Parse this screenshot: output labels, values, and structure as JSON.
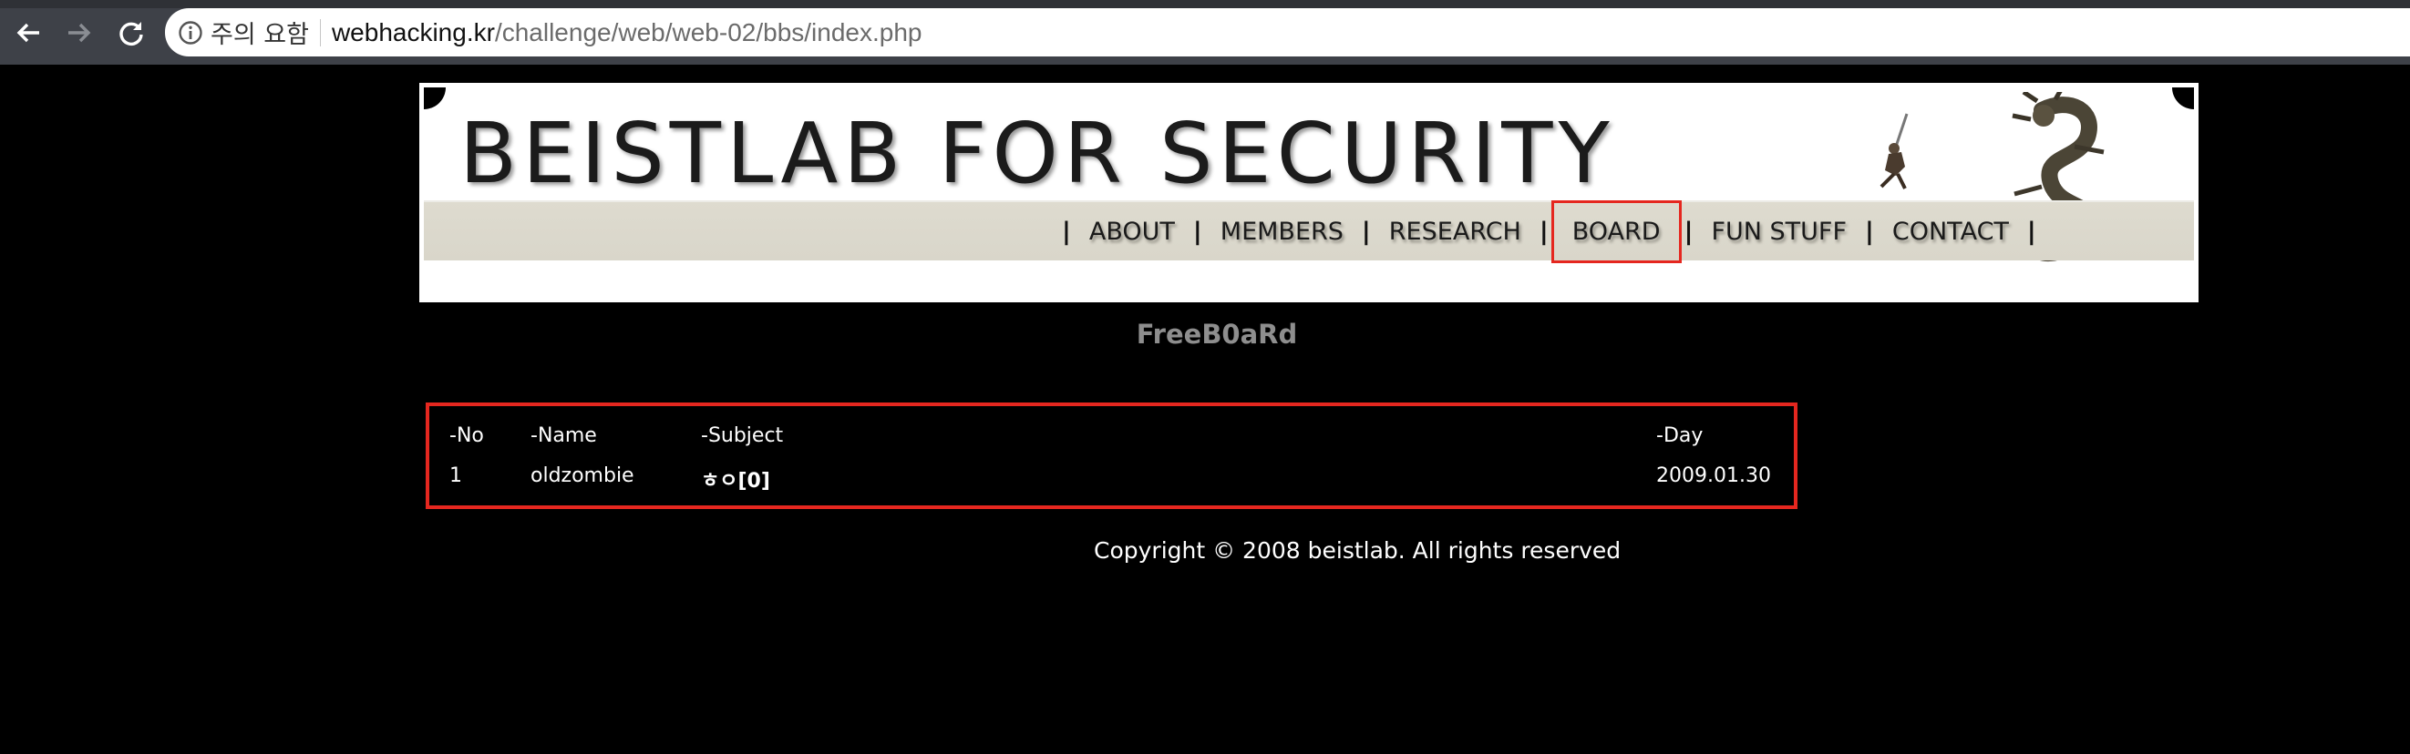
{
  "browser": {
    "back_icon": "arrow-left-icon",
    "forward_icon": "arrow-right-icon",
    "reload_icon": "reload-icon",
    "security_icon": "info-circle-icon",
    "security_label": "주의 요함",
    "url_host": "webhacking.kr",
    "url_path": "/challenge/web/web-02/bbs/index.php"
  },
  "header": {
    "logo": "BEISTLAB FOR SECURITY",
    "menu": [
      "ABOUT",
      "MEMBERS",
      "RESEARCH",
      "BOARD",
      "FUN STUFF",
      "CONTACT"
    ],
    "active_menu": "BOARD",
    "pipe": "|"
  },
  "board": {
    "title": "FreeB0aRd",
    "headers": {
      "no": "-No",
      "name": "-Name",
      "subject": "-Subject",
      "day": "-Day"
    },
    "rows": [
      {
        "no": "1",
        "name": "oldzombie",
        "subject": "ㅎㅇ[0]",
        "day": "2009.01.30"
      }
    ]
  },
  "footer": {
    "copyright": "Copyright © 2008 beistlab. All rights reserved"
  },
  "colors": {
    "highlight": "#e5271f",
    "page_bg": "#000000",
    "title_gray": "#8e8e8e"
  }
}
